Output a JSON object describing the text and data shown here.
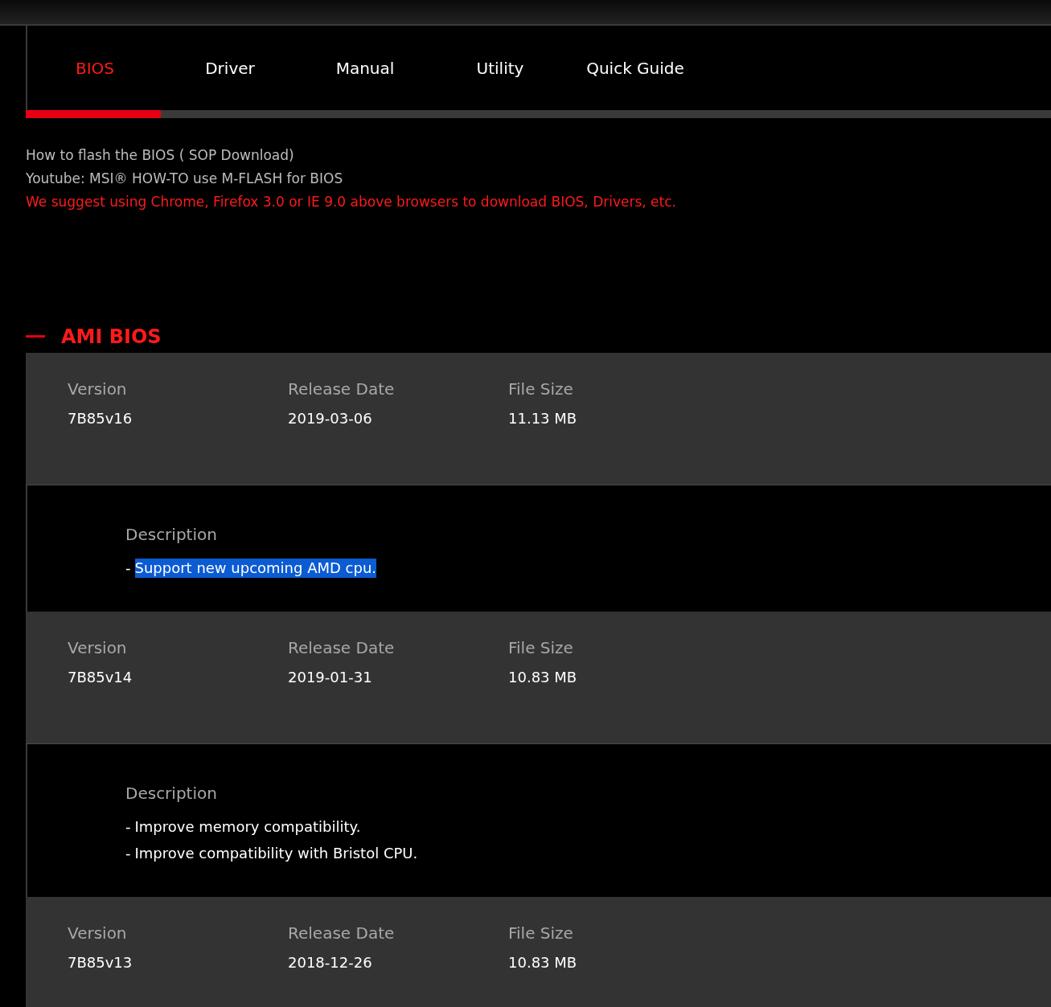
{
  "tabs": [
    {
      "label": "BIOS",
      "selected": true
    },
    {
      "label": "Driver",
      "selected": false
    },
    {
      "label": "Manual",
      "selected": false
    },
    {
      "label": "Utility",
      "selected": false
    },
    {
      "label": "Quick Guide",
      "selected": false
    }
  ],
  "notes": [
    {
      "text": "How to flash the BIOS ( SOP Download)",
      "kind": "link"
    },
    {
      "text": "Youtube: MSI® HOW-TO use M-FLASH for BIOS",
      "kind": "link"
    },
    {
      "text": "We suggest using Chrome, Firefox 3.0 or IE 9.0 above browsers to download BIOS, Drivers, etc.",
      "kind": "warning"
    }
  ],
  "section": {
    "title": "AMI BIOS",
    "expanded": true
  },
  "releases": [
    {
      "fields": [
        {
          "label": "Version",
          "value": "7B85v16"
        },
        {
          "label": "Release Date",
          "value": "2019-03-06"
        },
        {
          "label": "File Size",
          "value": "11.13 MB"
        }
      ],
      "description": {
        "label": "Description",
        "lines": [
          {
            "bullet": "-",
            "text": "Support new upcoming AMD cpu.",
            "highlighted": true
          }
        ]
      }
    },
    {
      "fields": [
        {
          "label": "Version",
          "value": "7B85v14"
        },
        {
          "label": "Release Date",
          "value": "2019-01-31"
        },
        {
          "label": "File Size",
          "value": "10.83 MB"
        }
      ],
      "description": {
        "label": "Description",
        "lines": [
          {
            "bullet": "-",
            "text": "Improve memory compatibility.",
            "highlighted": false
          },
          {
            "bullet": "-",
            "text": "Improve compatibility with Bristol CPU.",
            "highlighted": false
          }
        ]
      }
    },
    {
      "fields": [
        {
          "label": "Version",
          "value": "7B85v13"
        },
        {
          "label": "Release Date",
          "value": "2018-12-26"
        },
        {
          "label": "File Size",
          "value": "10.83 MB"
        }
      ]
    }
  ]
}
